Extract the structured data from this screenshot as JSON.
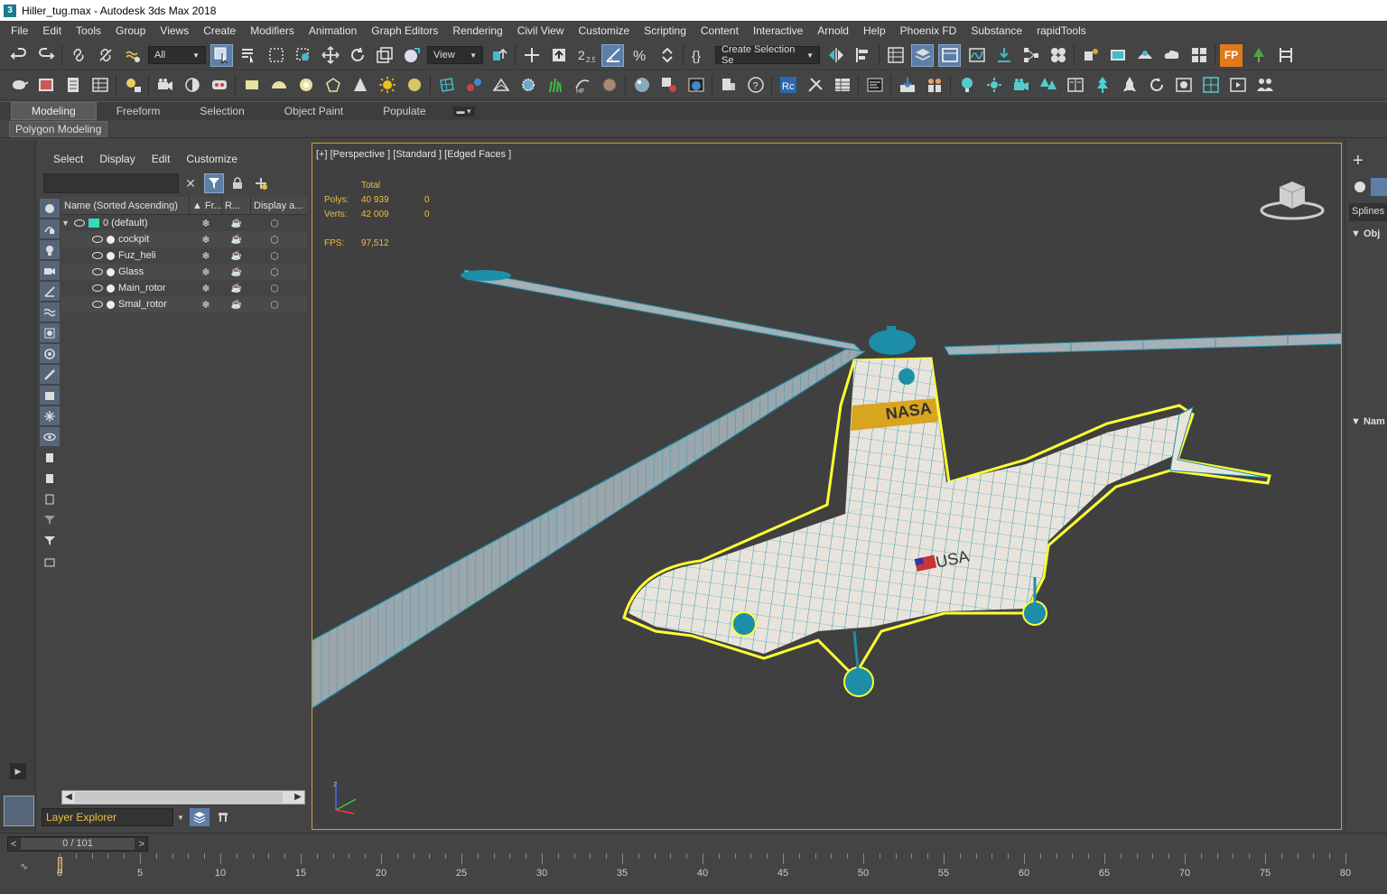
{
  "window": {
    "title": "Hiller_tug.max - Autodesk 3ds Max 2018",
    "app_icon": "3"
  },
  "menu": [
    "File",
    "Edit",
    "Tools",
    "Group",
    "Views",
    "Create",
    "Modifiers",
    "Animation",
    "Graph Editors",
    "Rendering",
    "Civil View",
    "Customize",
    "Scripting",
    "Content",
    "Interactive",
    "Arnold",
    "Help",
    "Phoenix FD",
    "Substance",
    "rapidTools"
  ],
  "toolbar": {
    "selection_filter": "All",
    "reference_coord": "View",
    "named_selection": "Create Selection Se",
    "snap_angle_label": "2.5",
    "fp_label": "FP"
  },
  "ribbon": {
    "tabs": [
      "Modeling",
      "Freeform",
      "Selection",
      "Object Paint",
      "Populate"
    ],
    "active_tab": "Modeling",
    "sub_label": "Polygon Modeling"
  },
  "scene_explorer": {
    "menu": [
      "Select",
      "Display",
      "Edit",
      "Customize"
    ],
    "search_placeholder": "",
    "columns": [
      "Name (Sorted Ascending)",
      "▲ Fr...",
      "R...",
      "Display a..."
    ],
    "root": "0 (default)",
    "items": [
      "cockpit",
      "Fuz_heli",
      "Glass",
      "Main_rotor",
      "Smal_rotor"
    ],
    "explorer_name": "Layer Explorer"
  },
  "viewport": {
    "label": "[+] [Perspective ] [Standard ] [Edged Faces ]",
    "stats": {
      "header": "Total",
      "polys_label": "Polys:",
      "polys_total": "40 939",
      "polys_sel": "0",
      "verts_label": "Verts:",
      "verts_total": "42 009",
      "verts_sel": "0",
      "fps_label": "FPS:",
      "fps_value": "97,512"
    },
    "decals": {
      "nasa": "NASA",
      "usa": "USA"
    },
    "axis_z": "z",
    "colors": {
      "mesh_fill": "#e8e4dc",
      "wire": "#1d8ea8",
      "selection": "#ffff33",
      "nasa_band": "#d9a51f",
      "viewport_bg": "#404040",
      "active_border": "#c9a227"
    }
  },
  "command_panel": {
    "tab": "Splines",
    "rollout1": "Obj",
    "rollout2": "Nam"
  },
  "timeline": {
    "frame_display": "0 / 101",
    "prev": "<",
    "next": ">",
    "ticks": [
      "0",
      "5",
      "10",
      "15",
      "20",
      "25",
      "30",
      "35",
      "40",
      "45",
      "50",
      "55",
      "60",
      "65",
      "70",
      "75",
      "80"
    ],
    "current_frame": 0,
    "key_mode_icon": "key-curve-icon"
  }
}
